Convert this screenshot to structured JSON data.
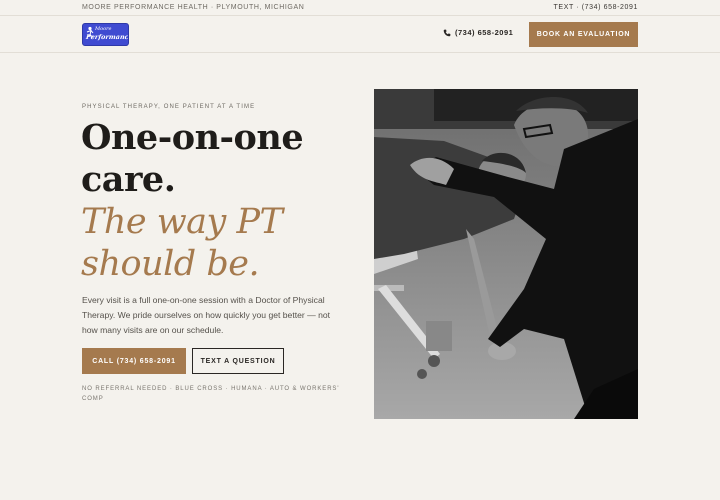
{
  "topbar": {
    "brand_location": "MOORE PERFORMANCE HEALTH · PLYMOUTH, MICHIGAN",
    "text_line": "TEXT · (734) 658-2091"
  },
  "header": {
    "logo": {
      "line1": "Moore",
      "line2": "Performance Health"
    },
    "phone": "(734) 658-2091",
    "book_button": "BOOK AN EVALUATION"
  },
  "hero": {
    "eyebrow": "PHYSICAL THERAPY, ONE PATIENT AT A TIME",
    "headline_line1": "One-on-one",
    "headline_line2": "care.",
    "accent_line1": "The way PT",
    "accent_line2": "should be.",
    "body": "Every visit is a full one-on-one session with a Doctor of Physical Therapy. We pride ourselves on how quickly you get better — not how many visits are on our schedule.",
    "call_button": "CALL (734) 658-2091",
    "text_button": "TEXT A QUESTION",
    "insurance": "NO REFERRAL NEEDED · BLUE CROSS · HUMANA · AUTO & WORKERS' COMP"
  },
  "colors": {
    "accent": "#a57a4e",
    "background": "#f4f2ed",
    "logo_blue": "#3f4bd1"
  },
  "icons": {
    "phone": "phone-icon"
  }
}
